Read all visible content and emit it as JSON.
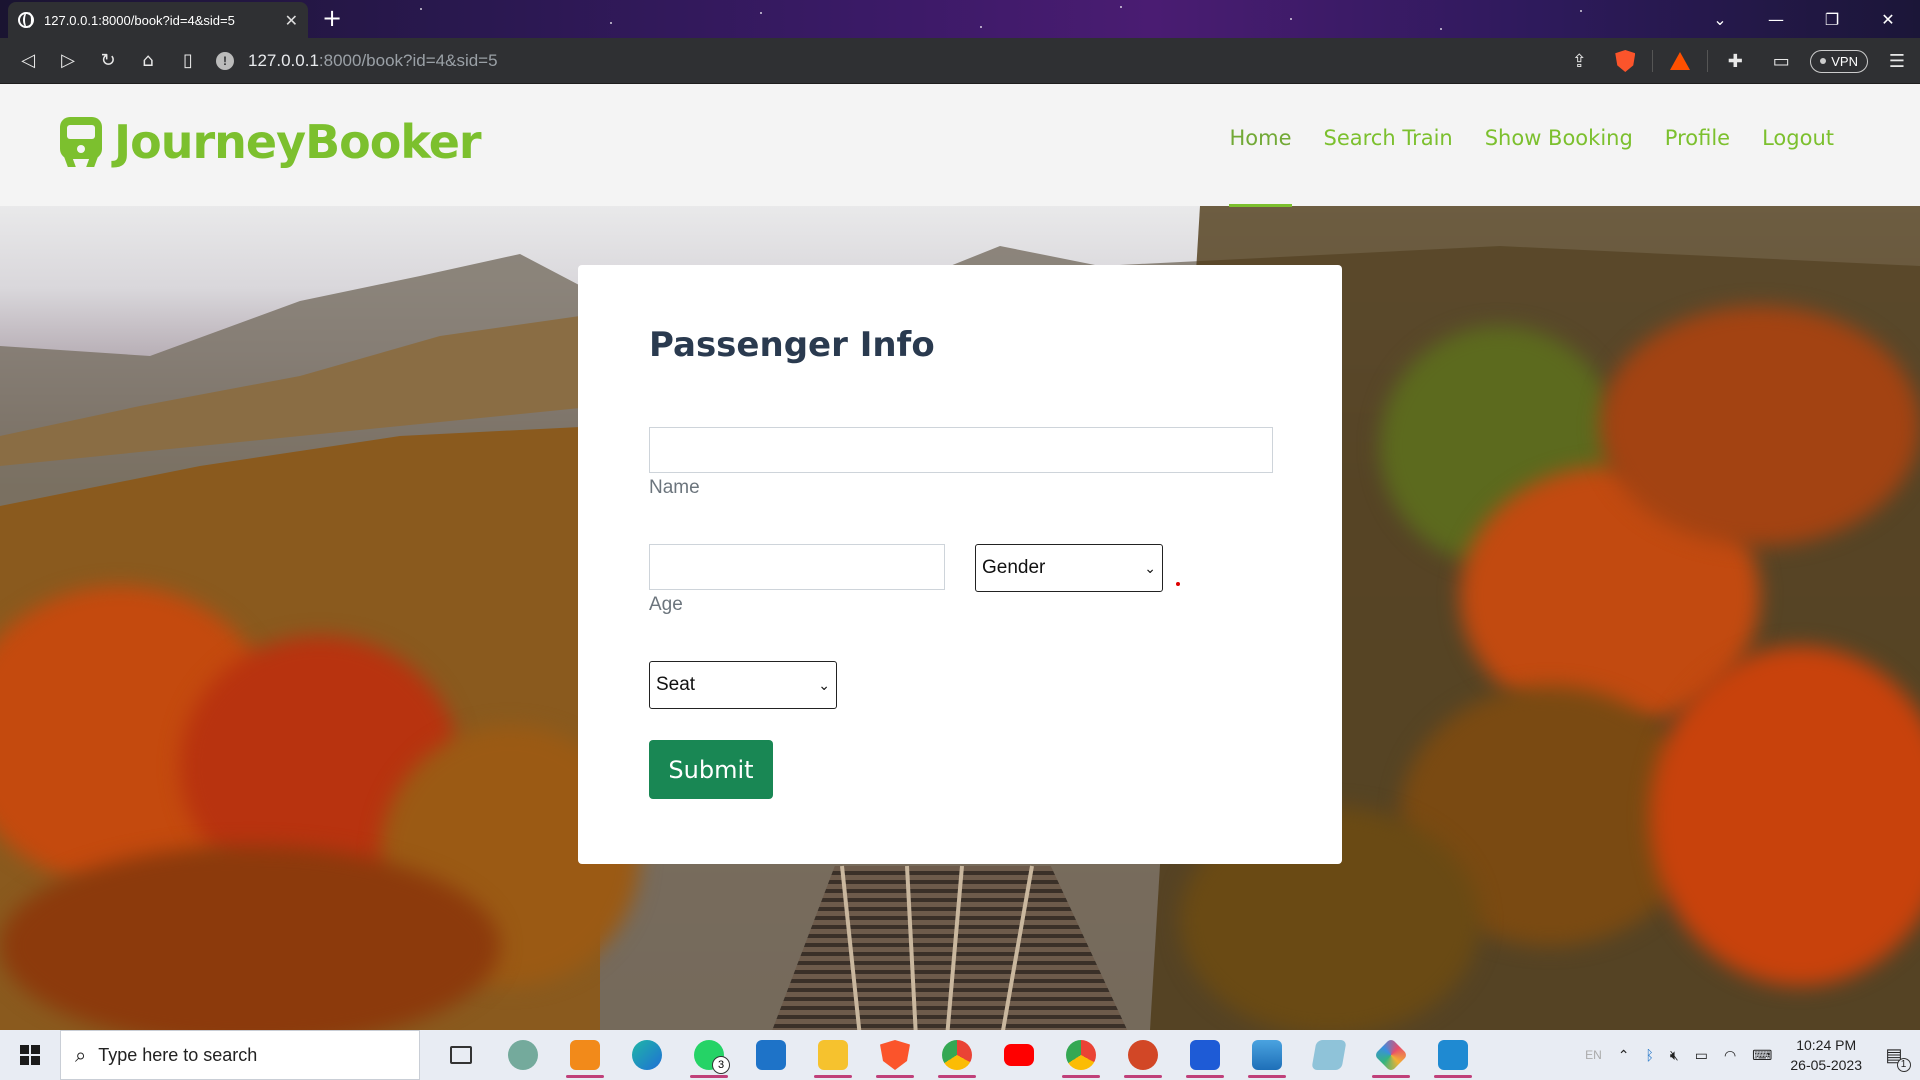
{
  "browser": {
    "tab_title": "127.0.0.1:8000/book?id=4&sid=5",
    "url_host": "127.0.0.1",
    "url_rest": ":8000/book?id=4&sid=5",
    "vpn_label": "VPN"
  },
  "site": {
    "brand": "JourneyBooker",
    "nav": [
      "Home",
      "Search Train",
      "Show Booking",
      "Profile",
      "Logout"
    ],
    "active_nav": "Home",
    "accent_color": "#7cc02e"
  },
  "form": {
    "heading": "Passenger Info",
    "name_label": "Name",
    "name_value": "",
    "age_label": "Age",
    "age_value": "",
    "gender_selected": "Gender",
    "seat_selected": "Seat",
    "submit_label": "Submit",
    "submit_color": "#198754"
  },
  "taskbar": {
    "search_placeholder": "Type here to search",
    "time": "10:24 PM",
    "date": "26-05-2023",
    "lang": "EN",
    "whatsapp_badge": "3",
    "notification_count": "1"
  }
}
